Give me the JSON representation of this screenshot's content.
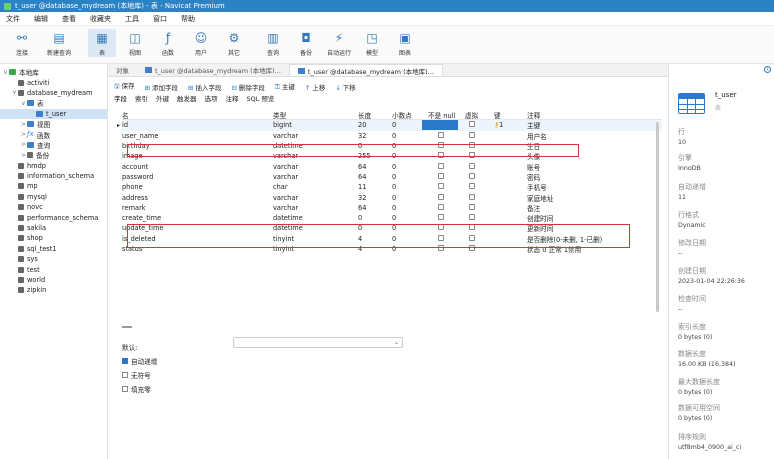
{
  "window": {
    "title": "t_user @database_mydream (本地库) - 表 - Navicat Premium"
  },
  "menu": [
    "文件",
    "编辑",
    "查看",
    "收藏夹",
    "工具",
    "窗口",
    "帮助"
  ],
  "toolbar": [
    {
      "label": "连接",
      "icon": "plug-icon"
    },
    {
      "label": "新建查询",
      "icon": "new-query-icon"
    },
    {
      "label": "表",
      "icon": "table-icon"
    },
    {
      "label": "视图",
      "icon": "view-icon"
    },
    {
      "label": "函数",
      "icon": "function-icon"
    },
    {
      "label": "用户",
      "icon": "user-icon"
    },
    {
      "label": "其它",
      "icon": "other-icon"
    },
    {
      "label": "查询",
      "icon": "query-icon"
    },
    {
      "label": "备份",
      "icon": "backup-icon"
    },
    {
      "label": "自动运行",
      "icon": "autorun-icon"
    },
    {
      "label": "模型",
      "icon": "model-icon"
    },
    {
      "label": "图表",
      "icon": "chart-icon"
    }
  ],
  "tree": [
    {
      "label": "本地库",
      "level": 0,
      "icon": "conn",
      "tw": "∨"
    },
    {
      "label": "activiti",
      "level": 1,
      "icon": "db",
      "tw": ""
    },
    {
      "label": "database_mydream",
      "level": 1,
      "icon": "db",
      "tw": "∨"
    },
    {
      "label": "表",
      "level": 2,
      "icon": "folder",
      "tw": "∨"
    },
    {
      "label": "t_user",
      "level": 3,
      "icon": "folder",
      "tw": "",
      "selected": true
    },
    {
      "label": "视图",
      "level": 2,
      "icon": "folder",
      "tw": ">"
    },
    {
      "label": "函数",
      "level": 2,
      "icon": "fx",
      "tw": ">"
    },
    {
      "label": "查询",
      "level": 2,
      "icon": "folder",
      "tw": ">"
    },
    {
      "label": "备份",
      "level": 2,
      "icon": "db",
      "tw": ">"
    },
    {
      "label": "hmdp",
      "level": 1,
      "icon": "db",
      "tw": ""
    },
    {
      "label": "information_schema",
      "level": 1,
      "icon": "db",
      "tw": ""
    },
    {
      "label": "mp",
      "level": 1,
      "icon": "db",
      "tw": ""
    },
    {
      "label": "mysql",
      "level": 1,
      "icon": "db",
      "tw": ""
    },
    {
      "label": "novc",
      "level": 1,
      "icon": "db",
      "tw": ""
    },
    {
      "label": "performance_schema",
      "level": 1,
      "icon": "db",
      "tw": ""
    },
    {
      "label": "sakila",
      "level": 1,
      "icon": "db",
      "tw": ""
    },
    {
      "label": "shop",
      "level": 1,
      "icon": "db",
      "tw": ""
    },
    {
      "label": "sql_test1",
      "level": 1,
      "icon": "db",
      "tw": ""
    },
    {
      "label": "sys",
      "level": 1,
      "icon": "db",
      "tw": ""
    },
    {
      "label": "test",
      "level": 1,
      "icon": "db",
      "tw": ""
    },
    {
      "label": "world",
      "level": 1,
      "icon": "db",
      "tw": ""
    },
    {
      "label": "zipkin",
      "level": 1,
      "icon": "db",
      "tw": ""
    }
  ],
  "tabs": [
    {
      "label": "对象",
      "active": false
    },
    {
      "label": "t_user @database_mydream (本地库)...",
      "active": false
    },
    {
      "label": "t_user @database_mydream (本地库)...",
      "active": true
    }
  ],
  "actions": [
    {
      "label": "保存",
      "glyph": "🖫"
    },
    {
      "label": "添加字段",
      "glyph": "⊞"
    },
    {
      "label": "插入字段",
      "glyph": "⊞"
    },
    {
      "label": "删除字段",
      "glyph": "⊟"
    },
    {
      "label": "主键",
      "glyph": "⚿"
    },
    {
      "label": "上移",
      "glyph": "↑"
    },
    {
      "label": "下移",
      "glyph": "↓"
    }
  ],
  "subtabs": [
    "字段",
    "索引",
    "外键",
    "触发器",
    "选项",
    "注释",
    "SQL 预览"
  ],
  "columns": [
    "名",
    "类型",
    "长度",
    "小数点",
    "不是 null",
    "虚拟",
    "键",
    "注释"
  ],
  "fields": [
    {
      "name": "id",
      "type": "bigint",
      "len": "20",
      "dec": "0",
      "notnull": true,
      "virtual": false,
      "key": "1",
      "comment": "主键",
      "current": true
    },
    {
      "name": "user_name",
      "type": "varchar",
      "len": "32",
      "dec": "0",
      "notnull": false,
      "virtual": false,
      "key": "",
      "comment": "用户名"
    },
    {
      "name": "birthday",
      "type": "datetime",
      "len": "0",
      "dec": "0",
      "notnull": false,
      "virtual": false,
      "key": "",
      "comment": "生日"
    },
    {
      "name": "image",
      "type": "varchar",
      "len": "255",
      "dec": "0",
      "notnull": false,
      "virtual": false,
      "key": "",
      "comment": "头像"
    },
    {
      "name": "account",
      "type": "varchar",
      "len": "64",
      "dec": "0",
      "notnull": false,
      "virtual": false,
      "key": "",
      "comment": "账号"
    },
    {
      "name": "password",
      "type": "varchar",
      "len": "64",
      "dec": "0",
      "notnull": false,
      "virtual": false,
      "key": "",
      "comment": "密码"
    },
    {
      "name": "phone",
      "type": "char",
      "len": "11",
      "dec": "0",
      "notnull": false,
      "virtual": false,
      "key": "",
      "comment": "手机号"
    },
    {
      "name": "address",
      "type": "varchar",
      "len": "32",
      "dec": "0",
      "notnull": false,
      "virtual": false,
      "key": "",
      "comment": "家庭地址"
    },
    {
      "name": "remark",
      "type": "varchar",
      "len": "64",
      "dec": "0",
      "notnull": false,
      "virtual": false,
      "key": "",
      "comment": "备注"
    },
    {
      "name": "create_time",
      "type": "datetime",
      "len": "0",
      "dec": "0",
      "notnull": false,
      "virtual": false,
      "key": "",
      "comment": "创建时间"
    },
    {
      "name": "update_time",
      "type": "datetime",
      "len": "0",
      "dec": "0",
      "notnull": false,
      "virtual": false,
      "key": "",
      "comment": "更新时间"
    },
    {
      "name": "is_deleted",
      "type": "tinyint",
      "len": "4",
      "dec": "0",
      "notnull": false,
      "virtual": false,
      "key": "",
      "comment": "是否删除(0-未删, 1-已删)"
    },
    {
      "name": "status",
      "type": "tinyint",
      "len": "4",
      "dec": "0",
      "notnull": false,
      "virtual": false,
      "key": "",
      "comment": "状态 0 正常 1禁用"
    }
  ],
  "props": {
    "default_label": "默认:",
    "auto_increment": {
      "label": "自动递增",
      "checked": true
    },
    "unsigned": {
      "label": "无符号",
      "checked": false
    },
    "zerofill": {
      "label": "填充零",
      "checked": false
    }
  },
  "info": {
    "name": "t_user",
    "sub": "表",
    "items": [
      {
        "k": "行",
        "v": "10"
      },
      {
        "k": "引擎",
        "v": "InnoDB"
      },
      {
        "k": "自动递增",
        "v": "11"
      },
      {
        "k": "行格式",
        "v": "Dynamic"
      },
      {
        "k": "修改日期",
        "v": "--"
      },
      {
        "k": "创建日期",
        "v": "2023-01-04 22:26:36"
      },
      {
        "k": "检查时间",
        "v": "--"
      },
      {
        "k": "索引长度",
        "v": "0 bytes (0)"
      },
      {
        "k": "数据长度",
        "v": "16.00 KB (16,384)"
      },
      {
        "k": "最大数据长度",
        "v": "0 bytes (0)"
      },
      {
        "k": "数据可用空间",
        "v": "0 bytes (0)"
      },
      {
        "k": "排序规则",
        "v": "utf8mb4_0900_ai_ci"
      }
    ]
  },
  "highlight_color": "#d8323a",
  "accent_color": "#2c78c9"
}
